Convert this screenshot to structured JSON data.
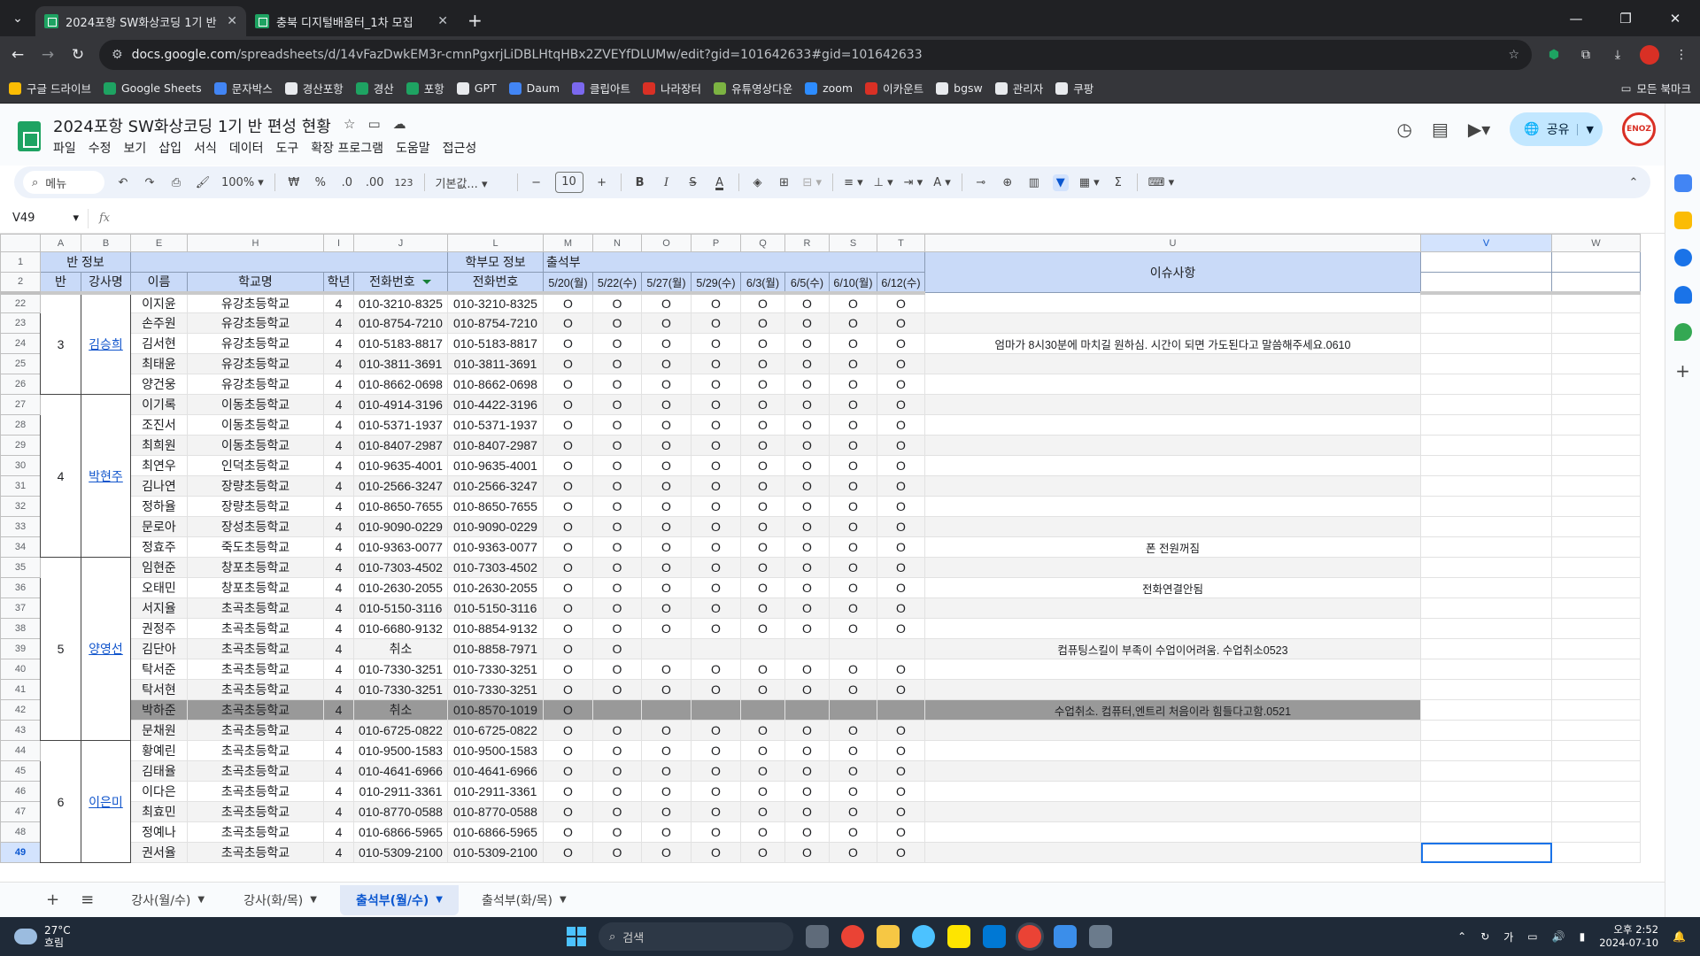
{
  "browser": {
    "tabs": [
      {
        "title": "2024포항 SW화상코딩 1기 반",
        "active": true
      },
      {
        "title": "충북 디지털배움터_1차 모집",
        "active": false
      }
    ],
    "url_host": "docs.google.com",
    "url_path": "/spreadsheets/d/14vFazDwkEM3r-cmnPgxrjLiDBLHtqHBx2ZVEYfDLUMw/edit?gid=101642633#gid=101642633",
    "bookmarks": [
      {
        "label": "구글 드라이브",
        "color": "#fbbc04"
      },
      {
        "label": "Google Sheets",
        "color": "#1ea362"
      },
      {
        "label": "문자박스",
        "color": "#4285f4"
      },
      {
        "label": "경산포항",
        "color": "#e8eaed"
      },
      {
        "label": "경산",
        "color": "#1ea362"
      },
      {
        "label": "포항",
        "color": "#1ea362"
      },
      {
        "label": "GPT",
        "color": "#e8eaed"
      },
      {
        "label": "Daum",
        "color": "#4285f4"
      },
      {
        "label": "클립아트",
        "color": "#7b68ee"
      },
      {
        "label": "나라장터",
        "color": "#d93025"
      },
      {
        "label": "유튜영상다운",
        "color": "#7cb342"
      },
      {
        "label": "zoom",
        "color": "#2d8cff"
      },
      {
        "label": "이카운트",
        "color": "#d93025"
      },
      {
        "label": "bgsw",
        "color": "#e8eaed"
      },
      {
        "label": "관리자",
        "color": "#e8eaed"
      },
      {
        "label": "쿠팡",
        "color": "#e8eaed"
      }
    ],
    "bookmarks_all": "모든 북마크"
  },
  "doc": {
    "title": "2024포항 SW화상코딩 1기 반 편성 현황",
    "menu": [
      "파일",
      "수정",
      "보기",
      "삽입",
      "서식",
      "데이터",
      "도구",
      "확장 프로그램",
      "도움말",
      "접근성"
    ],
    "share_label": "공유",
    "avatar_text": "ENOZ"
  },
  "toolbar": {
    "search_label": "메뉴",
    "zoom": "100%",
    "currency": "₩",
    "percent": "%",
    "dec_less": ".0",
    "dec_more": ".00",
    "num_fmt": "123",
    "font": "기본값...",
    "font_size": "10",
    "bold": "B",
    "italic": "I",
    "strike": "S",
    "text_color": "A"
  },
  "formula": {
    "cell_ref": "V49",
    "fx": "fx"
  },
  "columns": [
    {
      "id": "A",
      "w": 46
    },
    {
      "id": "B",
      "w": 56
    },
    {
      "id": "E",
      "w": 64
    },
    {
      "id": "H",
      "w": 154
    },
    {
      "id": "I",
      "w": 34
    },
    {
      "id": "J",
      "w": 106
    },
    {
      "id": "L",
      "w": 108
    },
    {
      "id": "M",
      "w": 56
    },
    {
      "id": "N",
      "w": 55
    },
    {
      "id": "O",
      "w": 56
    },
    {
      "id": "P",
      "w": 56
    },
    {
      "id": "Q",
      "w": 50
    },
    {
      "id": "R",
      "w": 50
    },
    {
      "id": "S",
      "w": 54
    },
    {
      "id": "T",
      "w": 54
    },
    {
      "id": "U",
      "w": 560
    },
    {
      "id": "V",
      "w": 148
    },
    {
      "id": "W",
      "w": 100
    }
  ],
  "header": {
    "row1": {
      "ban_info": "반 정보",
      "parent_info": "학부모 정보",
      "attendance": "출석부",
      "issues": "이슈사항"
    },
    "row2": {
      "ban": "반",
      "teacher": "강사명",
      "name": "이름",
      "school": "학교명",
      "grade": "학년",
      "phone": "전화번호",
      "parent_phone": "전화번호",
      "dates": [
        "5/20(월)",
        "5/22(수)",
        "5/27(월)",
        "5/29(수)",
        "6/3(월)",
        "6/5(수)",
        "6/10(월)",
        "6/12(수)"
      ]
    }
  },
  "groups": [
    {
      "ban": "3",
      "teacher": "김승희",
      "start": 22,
      "span": 5
    },
    {
      "ban": "4",
      "teacher": "박현주",
      "start": 27,
      "span": 8
    },
    {
      "ban": "5",
      "teacher": "양영선",
      "start": 35,
      "span": 9
    },
    {
      "ban": "6",
      "teacher": "이은미",
      "start": 44,
      "span": 6
    }
  ],
  "rows": [
    {
      "n": 22,
      "name": "이지윤",
      "school": "유강초등학교",
      "grade": "4",
      "phone": "010-3210-8325",
      "pphone": "010-3210-8325",
      "att": [
        "O",
        "O",
        "O",
        "O",
        "O",
        "O",
        "O",
        "O"
      ],
      "issue": ""
    },
    {
      "n": 23,
      "name": "손주원",
      "school": "유강초등학교",
      "grade": "4",
      "phone": "010-8754-7210",
      "pphone": "010-8754-7210",
      "att": [
        "O",
        "O",
        "O",
        "O",
        "O",
        "O",
        "O",
        "O"
      ],
      "issue": ""
    },
    {
      "n": 24,
      "name": "김서현",
      "school": "유강초등학교",
      "grade": "4",
      "phone": "010-5183-8817",
      "pphone": "010-5183-8817",
      "att": [
        "O",
        "O",
        "O",
        "O",
        "O",
        "O",
        "O",
        "O"
      ],
      "issue": "엄마가 8시30분에 마치길 원하심. 시간이 되면 가도된다고 말씀해주세요.0610"
    },
    {
      "n": 25,
      "name": "최태윤",
      "school": "유강초등학교",
      "grade": "4",
      "phone": "010-3811-3691",
      "pphone": "010-3811-3691",
      "att": [
        "O",
        "O",
        "O",
        "O",
        "O",
        "O",
        "O",
        "O"
      ],
      "issue": ""
    },
    {
      "n": 26,
      "name": "양건웅",
      "school": "유강초등학교",
      "grade": "4",
      "phone": "010-8662-0698",
      "pphone": "010-8662-0698",
      "att": [
        "O",
        "O",
        "O",
        "O",
        "O",
        "O",
        "O",
        "O"
      ],
      "issue": ""
    },
    {
      "n": 27,
      "name": "이기록",
      "school": "이동초등학교",
      "grade": "4",
      "phone": "010-4914-3196",
      "pphone": "010-4422-3196",
      "att": [
        "O",
        "O",
        "O",
        "O",
        "O",
        "O",
        "O",
        "O"
      ],
      "issue": ""
    },
    {
      "n": 28,
      "name": "조진서",
      "school": "이동초등학교",
      "grade": "4",
      "phone": "010-5371-1937",
      "pphone": "010-5371-1937",
      "att": [
        "O",
        "O",
        "O",
        "O",
        "O",
        "O",
        "O",
        "O"
      ],
      "issue": ""
    },
    {
      "n": 29,
      "name": "최희원",
      "school": "이동초등학교",
      "grade": "4",
      "phone": "010-8407-2987",
      "pphone": "010-8407-2987",
      "att": [
        "O",
        "O",
        "O",
        "O",
        "O",
        "O",
        "O",
        "O"
      ],
      "issue": ""
    },
    {
      "n": 30,
      "name": "최연우",
      "school": "인덕초등학교",
      "grade": "4",
      "phone": "010-9635-4001",
      "pphone": "010-9635-4001",
      "att": [
        "O",
        "O",
        "O",
        "O",
        "O",
        "O",
        "O",
        "O"
      ],
      "issue": ""
    },
    {
      "n": 31,
      "name": "김나연",
      "school": "장량초등학교",
      "grade": "4",
      "phone": "010-2566-3247",
      "pphone": "010-2566-3247",
      "att": [
        "O",
        "O",
        "O",
        "O",
        "O",
        "O",
        "O",
        "O"
      ],
      "issue": ""
    },
    {
      "n": 32,
      "name": "정하율",
      "school": "장량초등학교",
      "grade": "4",
      "phone": "010-8650-7655",
      "pphone": "010-8650-7655",
      "att": [
        "O",
        "O",
        "O",
        "O",
        "O",
        "O",
        "O",
        "O"
      ],
      "issue": ""
    },
    {
      "n": 33,
      "name": "문로아",
      "school": "장성초등학교",
      "grade": "4",
      "phone": "010-9090-0229",
      "pphone": "010-9090-0229",
      "att": [
        "O",
        "O",
        "O",
        "O",
        "O",
        "O",
        "O",
        "O"
      ],
      "issue": ""
    },
    {
      "n": 34,
      "name": "정효주",
      "school": "죽도초등학교",
      "grade": "4",
      "phone": "010-9363-0077",
      "pphone": "010-9363-0077",
      "att": [
        "O",
        "O",
        "O",
        "O",
        "O",
        "O",
        "O",
        "O"
      ],
      "issue": "폰 전원꺼짐"
    },
    {
      "n": 35,
      "name": "임현준",
      "school": "창포초등학교",
      "grade": "4",
      "phone": "010-7303-4502",
      "pphone": "010-7303-4502",
      "att": [
        "O",
        "O",
        "O",
        "O",
        "O",
        "O",
        "O",
        "O"
      ],
      "issue": ""
    },
    {
      "n": 36,
      "name": "오태민",
      "school": "창포초등학교",
      "grade": "4",
      "phone": "010-2630-2055",
      "pphone": "010-2630-2055",
      "att": [
        "O",
        "O",
        "O",
        "O",
        "O",
        "O",
        "O",
        "O"
      ],
      "issue": "전화연결안됨"
    },
    {
      "n": 37,
      "name": "서지율",
      "school": "초곡초등학교",
      "grade": "4",
      "phone": "010-5150-3116",
      "pphone": "010-5150-3116",
      "att": [
        "O",
        "O",
        "O",
        "O",
        "O",
        "O",
        "O",
        "O"
      ],
      "issue": ""
    },
    {
      "n": 38,
      "name": "권정주",
      "school": "초곡초등학교",
      "grade": "4",
      "phone": "010-6680-9132",
      "pphone": "010-8854-9132",
      "att": [
        "O",
        "O",
        "O",
        "O",
        "O",
        "O",
        "O",
        "O"
      ],
      "issue": ""
    },
    {
      "n": 39,
      "name": "김단아",
      "school": "초곡초등학교",
      "grade": "4",
      "phone": "취소",
      "pphone": "010-8858-7971",
      "att": [
        "O",
        "O",
        "",
        "",
        "",
        "",
        "",
        ""
      ],
      "issue": "컴퓨팅스킬이 부족이 수업이어려움. 수업취소0523",
      "dark": true
    },
    {
      "n": 40,
      "name": "탁서준",
      "school": "초곡초등학교",
      "grade": "4",
      "phone": "010-7330-3251",
      "pphone": "010-7330-3251",
      "att": [
        "O",
        "O",
        "O",
        "O",
        "O",
        "O",
        "O",
        "O"
      ],
      "issue": ""
    },
    {
      "n": 41,
      "name": "탁서현",
      "school": "초곡초등학교",
      "grade": "4",
      "phone": "010-7330-3251",
      "pphone": "010-7330-3251",
      "att": [
        "O",
        "O",
        "O",
        "O",
        "O",
        "O",
        "O",
        "O"
      ],
      "issue": ""
    },
    {
      "n": 42,
      "name": "박하준",
      "school": "초곡초등학교",
      "grade": "4",
      "phone": "취소",
      "pphone": "010-8570-1019",
      "att": [
        "O",
        "",
        "",
        "",
        "",
        "",
        "",
        ""
      ],
      "issue": "수업취소. 컴퓨터,엔트리 처음이라 힘들다고함.0521",
      "dark": true
    },
    {
      "n": 43,
      "name": "문채원",
      "school": "초곡초등학교",
      "grade": "4",
      "phone": "010-6725-0822",
      "pphone": "010-6725-0822",
      "att": [
        "O",
        "O",
        "O",
        "O",
        "O",
        "O",
        "O",
        "O"
      ],
      "issue": ""
    },
    {
      "n": 44,
      "name": "황예린",
      "school": "초곡초등학교",
      "grade": "4",
      "phone": "010-9500-1583",
      "pphone": "010-9500-1583",
      "att": [
        "O",
        "O",
        "O",
        "O",
        "O",
        "O",
        "O",
        "O"
      ],
      "issue": ""
    },
    {
      "n": 45,
      "name": "김태율",
      "school": "초곡초등학교",
      "grade": "4",
      "phone": "010-4641-6966",
      "pphone": "010-4641-6966",
      "att": [
        "O",
        "O",
        "O",
        "O",
        "O",
        "O",
        "O",
        "O"
      ],
      "issue": ""
    },
    {
      "n": 46,
      "name": "이다은",
      "school": "초곡초등학교",
      "grade": "4",
      "phone": "010-2911-3361",
      "pphone": "010-2911-3361",
      "att": [
        "O",
        "O",
        "O",
        "O",
        "O",
        "O",
        "O",
        "O"
      ],
      "issue": ""
    },
    {
      "n": 47,
      "name": "최효민",
      "school": "초곡초등학교",
      "grade": "4",
      "phone": "010-8770-0588",
      "pphone": "010-8770-0588",
      "att": [
        "O",
        "O",
        "O",
        "O",
        "O",
        "O",
        "O",
        "O"
      ],
      "issue": ""
    },
    {
      "n": 48,
      "name": "정예나",
      "school": "초곡초등학교",
      "grade": "4",
      "phone": "010-6866-5965",
      "pphone": "010-6866-5965",
      "att": [
        "O",
        "O",
        "O",
        "O",
        "O",
        "O",
        "O",
        "O"
      ],
      "issue": ""
    },
    {
      "n": 49,
      "name": "권서율",
      "school": "초곡초등학교",
      "grade": "4",
      "phone": "010-5309-2100",
      "pphone": "010-5309-2100",
      "att": [
        "O",
        "O",
        "O",
        "O",
        "O",
        "O",
        "O",
        "O"
      ],
      "issue": ""
    }
  ],
  "sheet_tabs": [
    {
      "label": "강사(월/수)",
      "active": false
    },
    {
      "label": "강사(화/목)",
      "active": false
    },
    {
      "label": "출석부(월/수)",
      "active": true
    },
    {
      "label": "출석부(화/목)",
      "active": false
    }
  ],
  "taskbar": {
    "temp": "27°C",
    "weather": "흐림",
    "search": "검색",
    "ime": "가",
    "time": "오후 2:52",
    "date": "2024-07-10"
  }
}
